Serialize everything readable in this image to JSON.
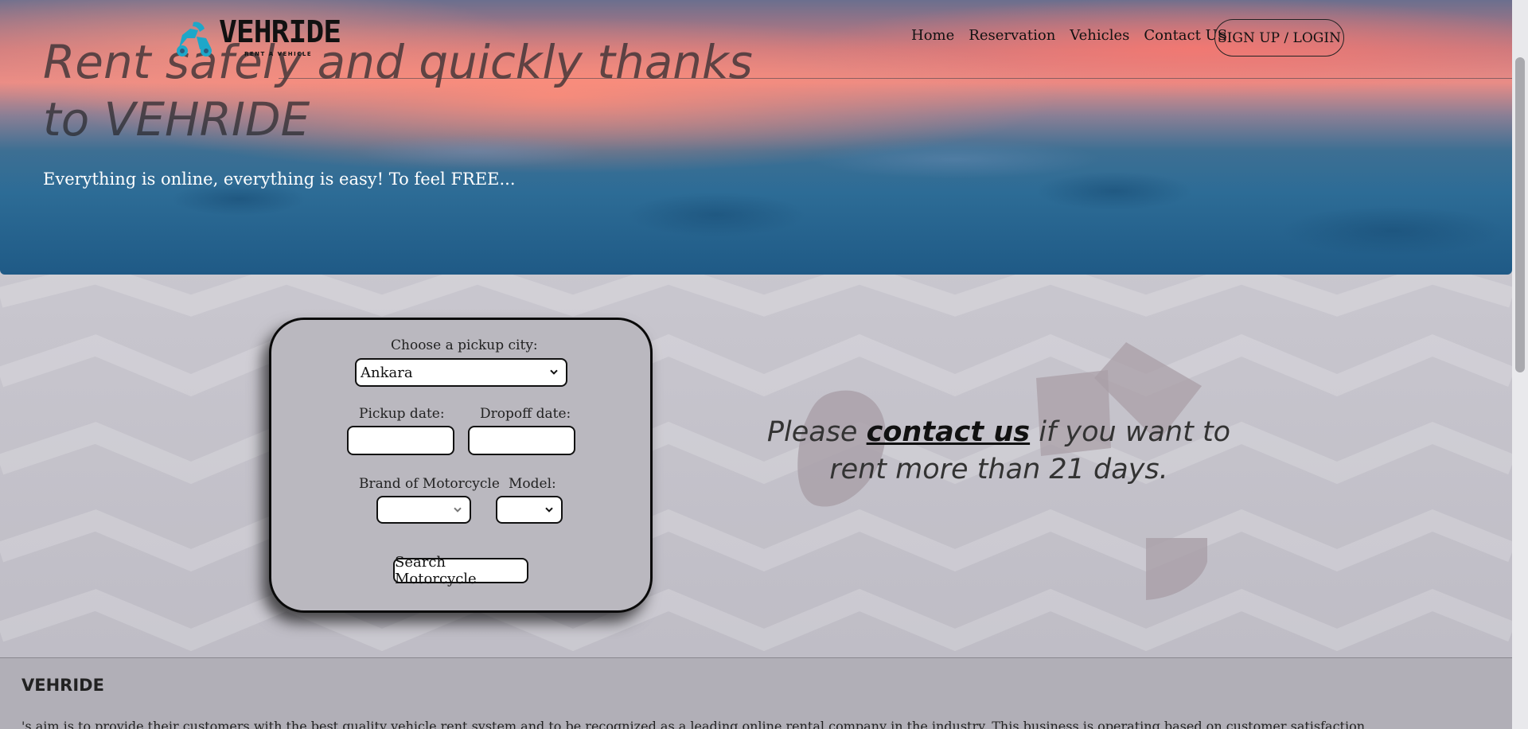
{
  "brand": {
    "logo_word": "VEHRIDE",
    "logo_tagline": "RENT A VEHICLE",
    "accent_color": "#1da7c9"
  },
  "nav": {
    "items": [
      {
        "label": "Home"
      },
      {
        "label": "Reservation"
      },
      {
        "label": "Vehicles"
      },
      {
        "label": "Contact US"
      }
    ],
    "signup_label": "SIGN UP / LOGIN"
  },
  "hero": {
    "title": "Rent safely and quickly thanks to VEHRIDE",
    "subtitle": "Everything is online, everything is easy! To feel FREE..."
  },
  "search": {
    "city_label": "Choose a pickup city:",
    "city_value": "Ankara",
    "pickup_label": "Pickup date:",
    "pickup_value": "",
    "dropoff_label": "Dropoff date:",
    "dropoff_value": "",
    "brand_label": "Brand of Motorcycle",
    "brand_value": "",
    "model_label": "Model:",
    "model_value": "",
    "submit_label": "Search Motorcycle"
  },
  "contact": {
    "prefix": "Please",
    "link": "contact us",
    "suffix": "if you want to rent more than 21 days."
  },
  "footer": {
    "title": "VEHRIDE",
    "text": "'s aim is to provide their customers with the best quality vehicle rent system and to be recognized as a leading online rental company in the industry. This business is operating based on customer satisfaction"
  }
}
